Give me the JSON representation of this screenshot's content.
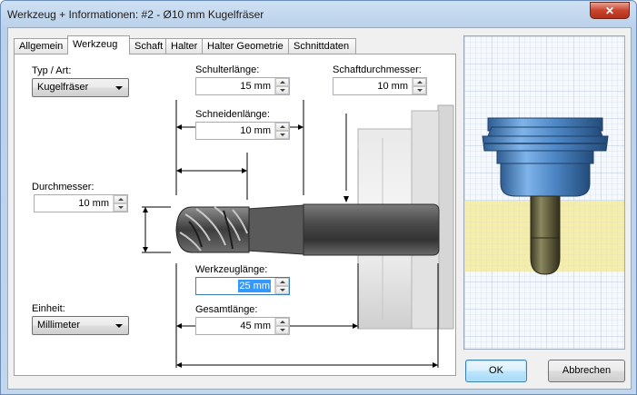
{
  "window": {
    "title": "Werkzeug + Informationen: #2 - Ø10 mm Kugelfräser",
    "close_glyph": "✕"
  },
  "tabs": [
    {
      "label": "Allgemein",
      "active": false
    },
    {
      "label": "Werkzeug",
      "active": true
    },
    {
      "label": "Schaft",
      "active": false
    },
    {
      "label": "Halter",
      "active": false
    },
    {
      "label": "Halter Geometrie",
      "active": false
    },
    {
      "label": "Schnittdaten",
      "active": false
    }
  ],
  "form": {
    "type_label": "Typ / Art:",
    "type_value": "Kugelfräser",
    "shoulder_length_label": "Schulterlänge:",
    "shoulder_length_value": "15 mm",
    "shank_diameter_label": "Schaftdurchmesser:",
    "shank_diameter_value": "10 mm",
    "cutting_length_label": "Schneidenlänge:",
    "cutting_length_value": "10 mm",
    "diameter_label": "Durchmesser:",
    "diameter_value": "10 mm",
    "tool_length_label": "Werkzeuglänge:",
    "tool_length_value": "25 mm",
    "total_length_label": "Gesamtlänge:",
    "total_length_value": "45 mm",
    "unit_label": "Einheit:",
    "unit_value": "Millimeter"
  },
  "buttons": {
    "ok": "OK",
    "cancel": "Abbrechen"
  },
  "colors": {
    "selection": "#3399ff",
    "preview_stock": "#f3eca8",
    "holder": "#4f86c9",
    "tool": "#5e5a3a"
  }
}
